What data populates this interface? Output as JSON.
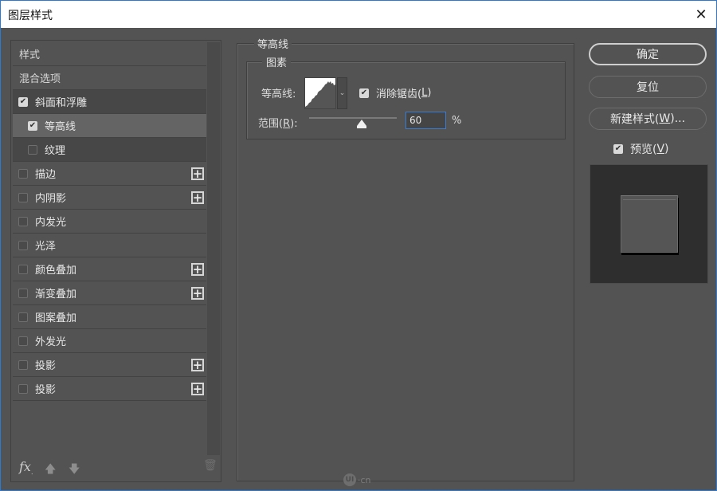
{
  "window": {
    "title": "图层样式",
    "close_glyph": "✕"
  },
  "left_panel": {
    "items": [
      {
        "label": "样式",
        "type": "header",
        "checkbox": false,
        "checked": false,
        "plus": false
      },
      {
        "label": "混合选项",
        "type": "header",
        "checkbox": false,
        "checked": false,
        "plus": false
      },
      {
        "label": "斜面和浮雕",
        "type": "effect",
        "checkbox": true,
        "checked": true,
        "plus": false
      },
      {
        "label": "等高线",
        "type": "sub",
        "checkbox": true,
        "checked": true,
        "plus": false,
        "selected": true
      },
      {
        "label": "纹理",
        "type": "sub",
        "checkbox": true,
        "checked": false,
        "plus": false
      },
      {
        "label": "描边",
        "type": "effect",
        "checkbox": true,
        "checked": false,
        "plus": true
      },
      {
        "label": "内阴影",
        "type": "effect",
        "checkbox": true,
        "checked": false,
        "plus": true
      },
      {
        "label": "内发光",
        "type": "effect",
        "checkbox": true,
        "checked": false,
        "plus": false
      },
      {
        "label": "光泽",
        "type": "effect",
        "checkbox": true,
        "checked": false,
        "plus": false
      },
      {
        "label": "颜色叠加",
        "type": "effect",
        "checkbox": true,
        "checked": false,
        "plus": true
      },
      {
        "label": "渐变叠加",
        "type": "effect",
        "checkbox": true,
        "checked": false,
        "plus": true
      },
      {
        "label": "图案叠加",
        "type": "effect",
        "checkbox": true,
        "checked": false,
        "plus": false
      },
      {
        "label": "外发光",
        "type": "effect",
        "checkbox": true,
        "checked": false,
        "plus": false
      },
      {
        "label": "投影",
        "type": "effect",
        "checkbox": true,
        "checked": false,
        "plus": true
      },
      {
        "label": "投影",
        "type": "effect",
        "checkbox": true,
        "checked": false,
        "plus": true
      }
    ],
    "plus_glyph": "+",
    "footer": {
      "fx_label": "fx",
      "fx_suffix": ".",
      "up_glyph": "🡅",
      "down_glyph": "🡇",
      "trash_glyph": "🗑"
    }
  },
  "contour_panel": {
    "group_title": "等高线",
    "subgroup_title": "图素",
    "contour_label": "等高线:",
    "dropdown_glyph": "⌄",
    "anti_alias": {
      "label_prefix": "消除锯齿(",
      "mnemonic": "L",
      "label_suffix": ")",
      "checked": true
    },
    "range": {
      "label_prefix": "范围(",
      "mnemonic": "R",
      "label_suffix": "):",
      "value": "60",
      "unit": "%",
      "slider_fraction": 0.6
    }
  },
  "actions": {
    "ok": "确定",
    "reset": "复位",
    "new_style_prefix": "新建样式(",
    "new_style_mnemonic": "W",
    "new_style_suffix": ")...",
    "preview": {
      "label_prefix": "预览(",
      "mnemonic": "V",
      "label_suffix": ")",
      "checked": true
    }
  },
  "watermark": {
    "logo": "UI",
    "text": "·cn"
  }
}
